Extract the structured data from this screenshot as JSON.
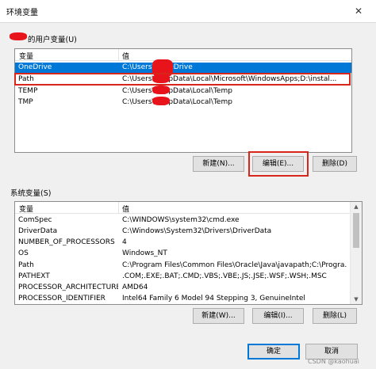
{
  "window": {
    "title": "环境变量",
    "close_glyph": "✕"
  },
  "user_section": {
    "label": "的用户变量(U)"
  },
  "user_list": {
    "columns": [
      "变量",
      "值"
    ],
    "rows": [
      {
        "name": "OneDrive",
        "value": "C:\\Users\\        \\OneDrive"
      },
      {
        "name": "Path",
        "value": "C:\\Users\\        \\AppData\\Local\\Microsoft\\WindowsApps;D:\\instal..."
      },
      {
        "name": "TEMP",
        "value": "C:\\Users\\        \\AppData\\Local\\Temp"
      },
      {
        "name": "TMP",
        "value": "C:\\Users\\        \\AppData\\Local\\Temp"
      }
    ]
  },
  "user_buttons": {
    "new": "新建(N)...",
    "edit": "编辑(E)...",
    "delete": "删除(D)"
  },
  "system_section": {
    "label": "系统变量(S)"
  },
  "system_list": {
    "columns": [
      "变量",
      "值"
    ],
    "rows": [
      {
        "name": "ComSpec",
        "value": "C:\\WINDOWS\\system32\\cmd.exe"
      },
      {
        "name": "DriverData",
        "value": "C:\\Windows\\System32\\Drivers\\DriverData"
      },
      {
        "name": "NUMBER_OF_PROCESSORS",
        "value": "4"
      },
      {
        "name": "OS",
        "value": "Windows_NT"
      },
      {
        "name": "Path",
        "value": "C:\\Program Files\\Common Files\\Oracle\\Java\\javapath;C:\\Progra..."
      },
      {
        "name": "PATHEXT",
        "value": ".COM;.EXE;.BAT;.CMD;.VBS;.VBE;.JS;.JSE;.WSF;.WSH;.MSC"
      },
      {
        "name": "PROCESSOR_ARCHITECTURE",
        "value": "AMD64"
      },
      {
        "name": "PROCESSOR_IDENTIFIER",
        "value": "Intel64 Family 6 Model 94 Stepping 3, GenuineIntel"
      }
    ]
  },
  "system_buttons": {
    "new": "新建(W)...",
    "edit": "编辑(I)...",
    "delete": "删除(L)"
  },
  "footer": {
    "ok": "确定",
    "cancel": "取消"
  },
  "watermark": "CSDN @kaohuai",
  "colors": {
    "selection": "#0078d7",
    "highlight_outline": "#d9261c",
    "redaction": "#e8141b"
  }
}
